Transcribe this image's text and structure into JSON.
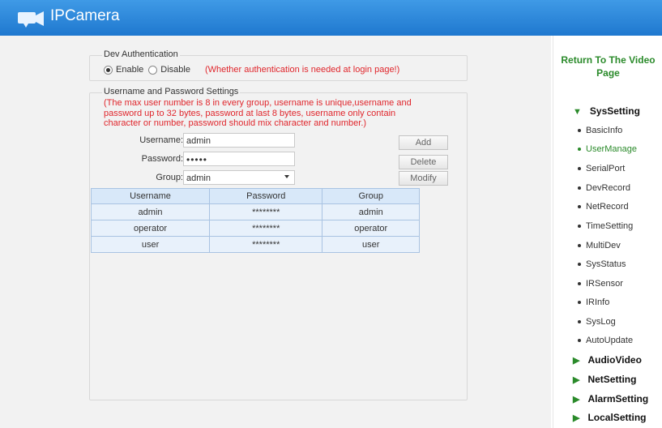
{
  "header": {
    "title": "IPCamera"
  },
  "auth": {
    "legend": "Dev Authentication",
    "enable_label": "Enable",
    "disable_label": "Disable",
    "note": "(Whether authentication is needed at login page!)",
    "selected": "Enable"
  },
  "userset": {
    "legend": "Username and Password Settings",
    "notice": "(The max user number is 8 in every group, username is unique,username and password up to 32 bytes, password at last 8 bytes, username only contain character or number, password should mix character and number.)",
    "username_label": "Username:",
    "username_value": "admin",
    "password_label": "Password:",
    "password_value": "•••••",
    "group_label": "Group:",
    "group_value": "admin",
    "add_label": "Add",
    "delete_label": "Delete",
    "modify_label": "Modify"
  },
  "table": {
    "headers": [
      "Username",
      "Password",
      "Group"
    ],
    "rows": [
      [
        "admin",
        "********",
        "admin"
      ],
      [
        "operator",
        "********",
        "operator"
      ],
      [
        "user",
        "********",
        "user"
      ]
    ]
  },
  "sidebar": {
    "return_label": "Return To The Video Page",
    "sections": [
      {
        "label": "SysSetting",
        "expanded": true
      },
      {
        "label": "AudioVideo",
        "expanded": false
      },
      {
        "label": "NetSetting",
        "expanded": false
      },
      {
        "label": "AlarmSetting",
        "expanded": false
      },
      {
        "label": "LocalSetting",
        "expanded": false
      }
    ],
    "items": [
      "BasicInfo",
      "UserManage",
      "SerialPort",
      "DevRecord",
      "NetRecord",
      "TimeSetting",
      "MultiDev",
      "SysStatus",
      "IRSensor",
      "IRInfo",
      "SysLog",
      "AutoUpdate"
    ],
    "active_item": "UserManage"
  },
  "colors": {
    "header": "#1f78cf",
    "accent_green": "#2a8a2a",
    "warning_red": "#e0262c"
  },
  "icons": {
    "logo": "camera-logo-icon"
  }
}
